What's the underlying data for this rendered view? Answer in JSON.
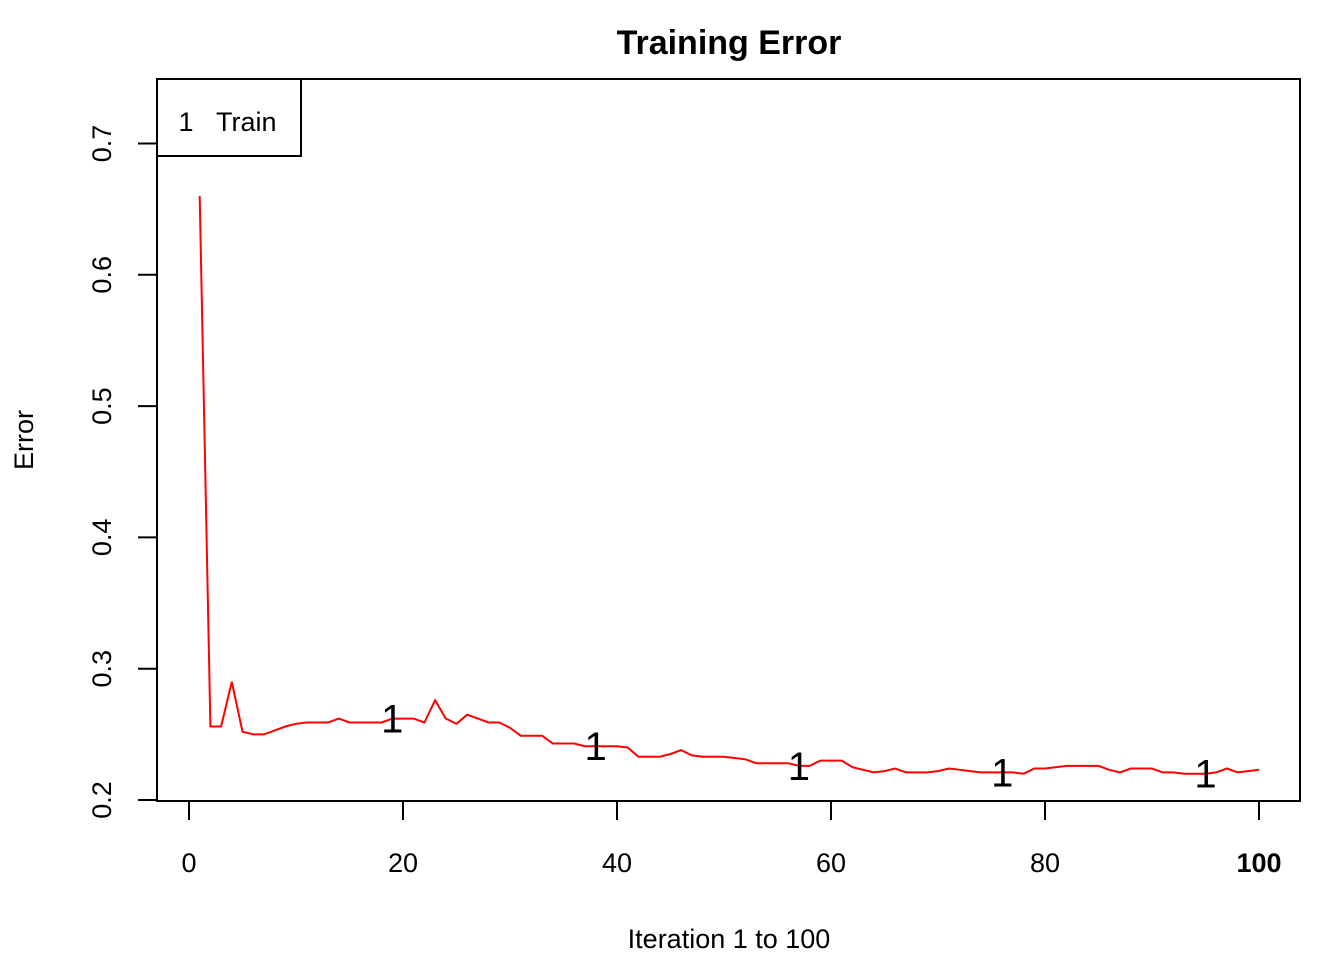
{
  "chart_data": {
    "type": "line",
    "title": "Training Error",
    "xlabel": "Iteration 1 to 100",
    "ylabel": "Error",
    "xlim": [
      -1.5,
      104.5
    ],
    "ylim": [
      0.2,
      0.745
    ],
    "x_ticks": [
      0,
      20,
      40,
      60,
      80,
      100
    ],
    "x_tick_labels": [
      "0",
      "20",
      "40",
      "60",
      "80",
      "100"
    ],
    "x_tick_bold": [
      false,
      false,
      false,
      false,
      false,
      true
    ],
    "y_ticks": [
      0.2,
      0.3,
      0.4,
      0.5,
      0.6,
      0.7
    ],
    "y_tick_labels": [
      "0.2",
      "0.3",
      "0.4",
      "0.5",
      "0.6",
      "0.7"
    ],
    "grid": false,
    "legend": {
      "position": "top-left",
      "entries": [
        {
          "symbol": "1",
          "label": "Train"
        }
      ]
    },
    "series": [
      {
        "name": "Train",
        "color": "#ff0000",
        "point_symbol": "1",
        "marker_iterations": [
          19,
          38,
          57,
          76,
          95
        ],
        "x": [
          1,
          2,
          3,
          4,
          5,
          6,
          7,
          8,
          9,
          10,
          11,
          12,
          13,
          14,
          15,
          16,
          17,
          18,
          19,
          20,
          21,
          22,
          23,
          24,
          25,
          26,
          27,
          28,
          29,
          30,
          31,
          32,
          33,
          34,
          35,
          36,
          37,
          38,
          39,
          40,
          41,
          42,
          43,
          44,
          45,
          46,
          47,
          48,
          49,
          50,
          51,
          52,
          53,
          54,
          55,
          56,
          57,
          58,
          59,
          60,
          61,
          62,
          63,
          64,
          65,
          66,
          67,
          68,
          69,
          70,
          71,
          72,
          73,
          74,
          75,
          76,
          77,
          78,
          79,
          80,
          81,
          82,
          83,
          84,
          85,
          86,
          87,
          88,
          89,
          90,
          91,
          92,
          93,
          94,
          95,
          96,
          97,
          98,
          99,
          100
        ],
        "values": [
          0.66,
          0.256,
          0.256,
          0.29,
          0.252,
          0.25,
          0.25,
          0.253,
          0.256,
          0.258,
          0.259,
          0.259,
          0.259,
          0.262,
          0.259,
          0.259,
          0.259,
          0.259,
          0.262,
          0.262,
          0.262,
          0.259,
          0.276,
          0.262,
          0.258,
          0.265,
          0.262,
          0.259,
          0.259,
          0.255,
          0.249,
          0.249,
          0.249,
          0.243,
          0.243,
          0.243,
          0.241,
          0.241,
          0.241,
          0.241,
          0.24,
          0.233,
          0.233,
          0.233,
          0.235,
          0.238,
          0.234,
          0.233,
          0.233,
          0.233,
          0.232,
          0.231,
          0.228,
          0.228,
          0.228,
          0.228,
          0.226,
          0.226,
          0.23,
          0.23,
          0.23,
          0.225,
          0.223,
          0.221,
          0.222,
          0.224,
          0.221,
          0.221,
          0.221,
          0.222,
          0.224,
          0.223,
          0.222,
          0.221,
          0.221,
          0.221,
          0.221,
          0.22,
          0.224,
          0.224,
          0.225,
          0.226,
          0.226,
          0.226,
          0.226,
          0.223,
          0.221,
          0.224,
          0.224,
          0.224,
          0.221,
          0.221,
          0.22,
          0.22,
          0.22,
          0.221,
          0.224,
          0.221,
          0.222,
          0.223
        ]
      }
    ]
  }
}
